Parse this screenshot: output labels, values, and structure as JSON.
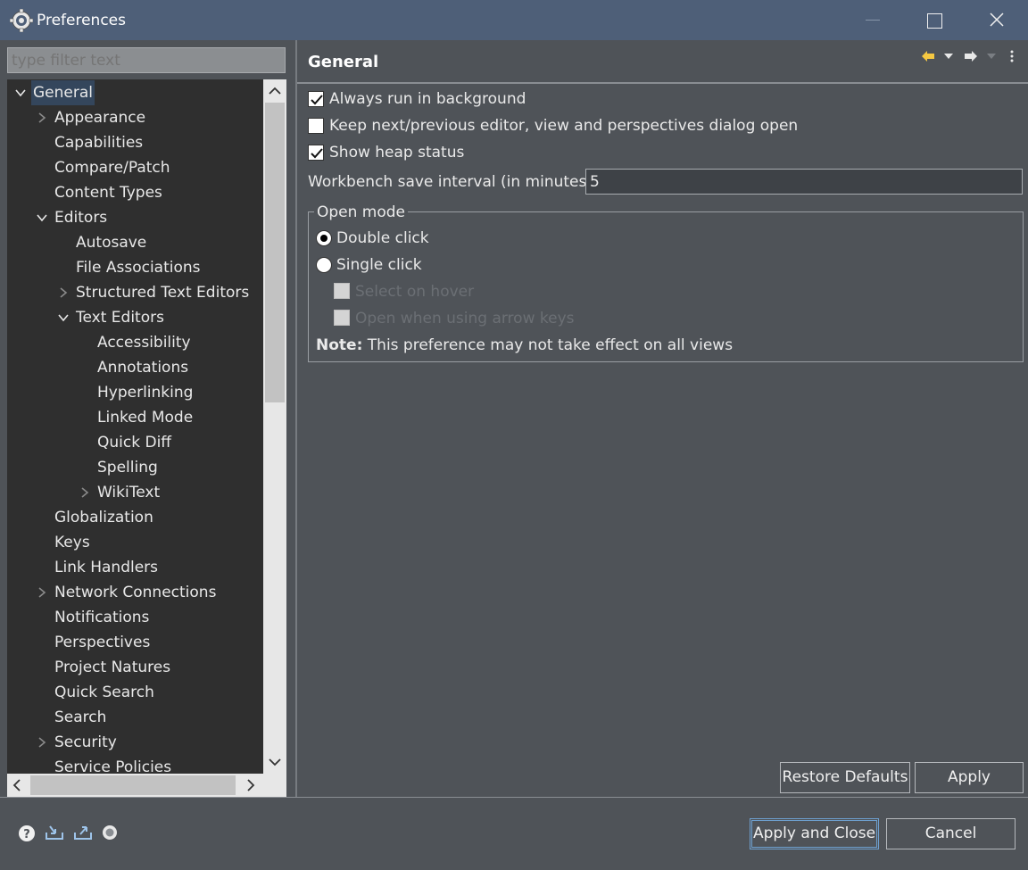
{
  "window": {
    "title": "Preferences"
  },
  "filter": {
    "placeholder": "type filter text"
  },
  "tree": {
    "items": [
      {
        "label": "General",
        "level": 0,
        "expander": "expanded",
        "selected": true
      },
      {
        "label": "Appearance",
        "level": 1,
        "expander": "collapsed"
      },
      {
        "label": "Capabilities",
        "level": 1,
        "expander": "none"
      },
      {
        "label": "Compare/Patch",
        "level": 1,
        "expander": "none"
      },
      {
        "label": "Content Types",
        "level": 1,
        "expander": "none"
      },
      {
        "label": "Editors",
        "level": 1,
        "expander": "expanded"
      },
      {
        "label": "Autosave",
        "level": 2,
        "expander": "none"
      },
      {
        "label": "File Associations",
        "level": 2,
        "expander": "none"
      },
      {
        "label": "Structured Text Editors",
        "level": 2,
        "expander": "collapsed"
      },
      {
        "label": "Text Editors",
        "level": 2,
        "expander": "expanded"
      },
      {
        "label": "Accessibility",
        "level": 3,
        "expander": "none"
      },
      {
        "label": "Annotations",
        "level": 3,
        "expander": "none"
      },
      {
        "label": "Hyperlinking",
        "level": 3,
        "expander": "none"
      },
      {
        "label": "Linked Mode",
        "level": 3,
        "expander": "none"
      },
      {
        "label": "Quick Diff",
        "level": 3,
        "expander": "none"
      },
      {
        "label": "Spelling",
        "level": 3,
        "expander": "none"
      },
      {
        "label": "WikiText",
        "level": 3,
        "expander": "collapsed"
      },
      {
        "label": "Globalization",
        "level": 1,
        "expander": "none"
      },
      {
        "label": "Keys",
        "level": 1,
        "expander": "none"
      },
      {
        "label": "Link Handlers",
        "level": 1,
        "expander": "none"
      },
      {
        "label": "Network Connections",
        "level": 1,
        "expander": "collapsed"
      },
      {
        "label": "Notifications",
        "level": 1,
        "expander": "none"
      },
      {
        "label": "Perspectives",
        "level": 1,
        "expander": "none"
      },
      {
        "label": "Project Natures",
        "level": 1,
        "expander": "none"
      },
      {
        "label": "Quick Search",
        "level": 1,
        "expander": "none"
      },
      {
        "label": "Search",
        "level": 1,
        "expander": "none"
      },
      {
        "label": "Security",
        "level": 1,
        "expander": "collapsed"
      },
      {
        "label": "Service Policies",
        "level": 1,
        "expander": "none"
      }
    ]
  },
  "page": {
    "title": "General",
    "options": {
      "always_run": {
        "label": "Always run in background",
        "checked": true
      },
      "keep_next": {
        "label": "Keep next/previous editor, view and perspectives dialog open",
        "checked": false
      },
      "show_heap": {
        "label": "Show heap status",
        "checked": true
      }
    },
    "interval": {
      "label": "Workbench save interval (in minutes):",
      "value": "5"
    },
    "open_mode": {
      "title": "Open mode",
      "double_click": "Double click",
      "single_click": "Single click",
      "select_on_hover": "Select on hover",
      "open_arrow_keys": "Open when using arrow keys",
      "note_label": "Note:",
      "note_text": " This preference may not take effect on all views"
    }
  },
  "buttons": {
    "restore_defaults": "Restore Defaults",
    "apply": "Apply",
    "apply_and_close": "Apply and Close",
    "cancel": "Cancel"
  },
  "colors": {
    "accent": "#6ea0cf",
    "selection": "#34465c",
    "titlebar": "#4e5f78"
  }
}
